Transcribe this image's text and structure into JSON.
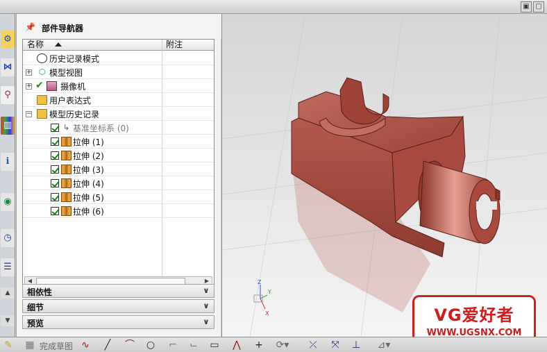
{
  "navigator": {
    "title": "部件导航器",
    "columns": {
      "name": "名称",
      "note": "附注"
    },
    "tree": [
      {
        "label": "历史记录模式",
        "icon": "clock-icon"
      },
      {
        "label": "模型视图",
        "icon": "model-view-icon"
      },
      {
        "label": "摄像机",
        "icon": "camera-icon"
      },
      {
        "label": "用户表达式",
        "icon": "folder-icon"
      },
      {
        "label": "模型历史记录",
        "icon": "folder-open-icon"
      },
      {
        "label": "基准坐标系 (0)",
        "icon": "datum-csys-icon"
      },
      {
        "label": "拉伸 (1)",
        "icon": "extrude-icon"
      },
      {
        "label": "拉伸 (2)",
        "icon": "extrude-icon"
      },
      {
        "label": "拉伸 (3)",
        "icon": "extrude-icon"
      },
      {
        "label": "拉伸 (4)",
        "icon": "extrude-icon"
      },
      {
        "label": "拉伸 (5)",
        "icon": "extrude-icon"
      },
      {
        "label": "拉伸 (6)",
        "icon": "extrude-icon"
      }
    ],
    "sections": {
      "dependencies": "相依性",
      "details": "细节",
      "preview": "预览"
    }
  },
  "viewport": {
    "triad": {
      "x": "X",
      "y": "Y",
      "z": "Z"
    },
    "model_color": "#b5574a"
  },
  "watermark": {
    "line1": "VG爱好者",
    "line2": "WWW.UGSNX.COM",
    "color": "#d41a1a"
  },
  "toolbar": {
    "finish_sketch": "完成草图"
  }
}
